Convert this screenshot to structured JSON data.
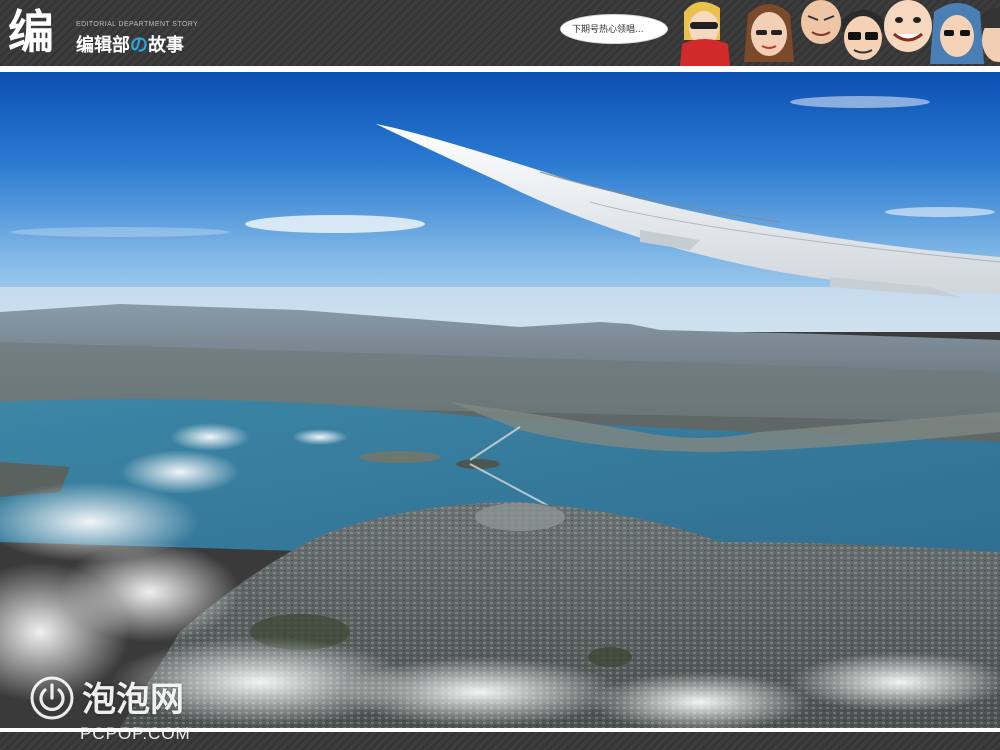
{
  "header": {
    "logo_mark": "编",
    "subtitle": "EDITORIAL DEPARTMENT STORY",
    "title_a": "编辑部",
    "title_hl": "の",
    "title_b": "故事",
    "speech_bubble": "下期号热心领唱...",
    "accent_color": "#29a7df"
  },
  "photo": {
    "subject": "aerial-view-from-airplane-window"
  },
  "watermark": {
    "icon": "power-icon",
    "name_cn": "泡泡网",
    "name_en": "PCPOP.COM"
  }
}
